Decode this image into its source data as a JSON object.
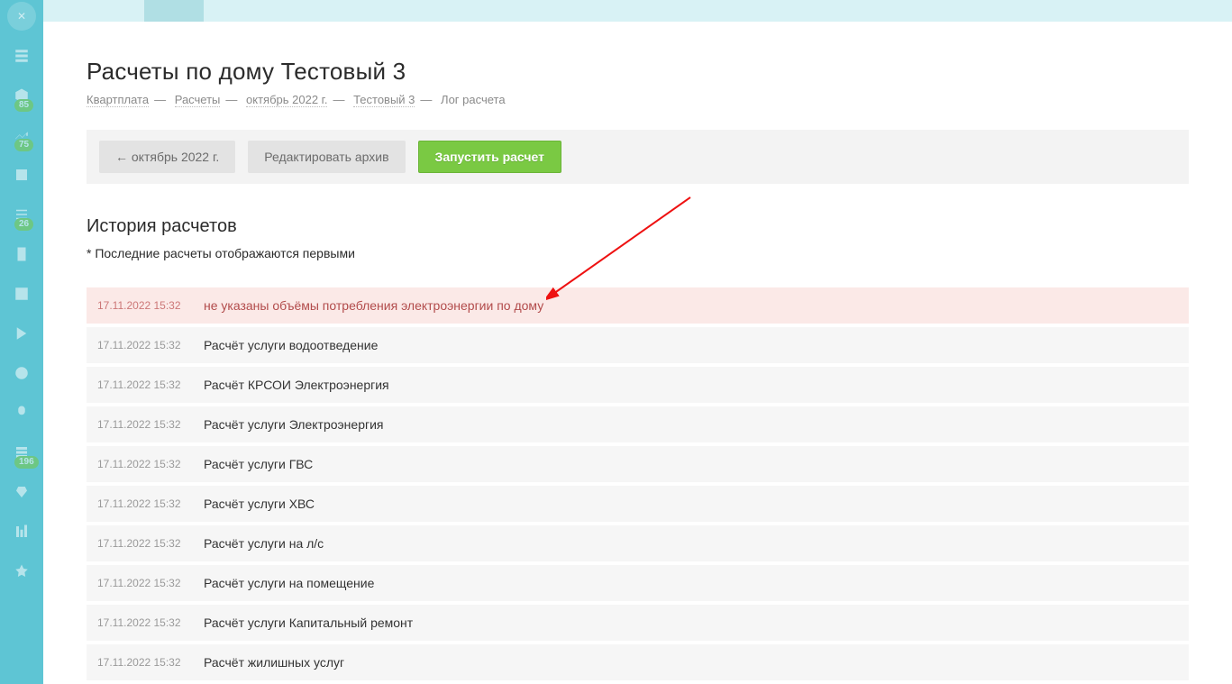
{
  "sidebar": {
    "badges": [
      "85",
      "75",
      "26",
      "196"
    ]
  },
  "page": {
    "title": "Расчеты по дому Тестовый 3"
  },
  "breadcrumbs": {
    "items": [
      "Квартплата",
      "Расчеты",
      "октябрь 2022 г.",
      "Тестовый 3",
      "Лог расчета"
    ]
  },
  "toolbar": {
    "back_label": "← октябрь 2022 г.",
    "edit_label": "Редактировать архив",
    "run_label": "Запустить расчет"
  },
  "history": {
    "title": "История расчетов",
    "note": "* Последние расчеты отображаются первыми",
    "rows": [
      {
        "time": "17.11.2022 15:32",
        "msg": "не указаны объёмы потребления электроэнергии по дому",
        "error": true
      },
      {
        "time": "17.11.2022 15:32",
        "msg": "Расчёт услуги водоотведение"
      },
      {
        "time": "17.11.2022 15:32",
        "msg": "Расчёт КРСОИ Электроэнергия"
      },
      {
        "time": "17.11.2022 15:32",
        "msg": "Расчёт услуги Электроэнергия"
      },
      {
        "time": "17.11.2022 15:32",
        "msg": "Расчёт услуги ГВС"
      },
      {
        "time": "17.11.2022 15:32",
        "msg": "Расчёт услуги ХВС"
      },
      {
        "time": "17.11.2022 15:32",
        "msg": "Расчёт услуги на л/с"
      },
      {
        "time": "17.11.2022 15:32",
        "msg": "Расчёт услуги на помещение"
      },
      {
        "time": "17.11.2022 15:32",
        "msg": "Расчёт услуги Капитальный ремонт"
      },
      {
        "time": "17.11.2022 15:32",
        "msg": "Расчёт жилишных услуг"
      }
    ]
  }
}
